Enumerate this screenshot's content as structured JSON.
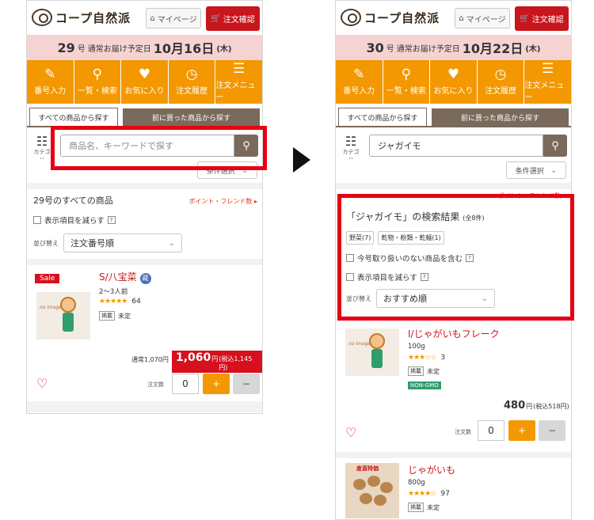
{
  "common": {
    "logo_text": "コープ自然派",
    "mypage_label": "マイページ",
    "order_confirm_label": "注文確認",
    "nav": [
      {
        "icon": "✎",
        "label": "番号入力"
      },
      {
        "icon": "⚲",
        "label": "一覧・検索"
      },
      {
        "icon": "♥",
        "label": "お気に入り"
      },
      {
        "icon": "◷",
        "label": "注文履歴"
      },
      {
        "icon": "☰",
        "label": "注文メニュー"
      }
    ],
    "tab_all": "すべての商品から探す",
    "tab_prev": "前に買った商品から探す",
    "category_label": "カテゴリ",
    "cond_select": "条件選択",
    "point_link": "ポイント・フレンド数 ▸",
    "reduce_items": "表示項目を減らす",
    "help": "?",
    "sort_label": "並び替え",
    "qty_label": "注文数",
    "qty_value": "0",
    "plus": "+",
    "minus": "−",
    "keisai_tag": "掲載",
    "keisai_value": "未定",
    "yen": "円"
  },
  "left": {
    "delivery": {
      "issue": "29",
      "issue_suffix": "号",
      "label": "通常お届け予定日",
      "date": "10月16日",
      "dow": "(木)"
    },
    "search": {
      "placeholder": "商品名、キーワードで探す",
      "value": ""
    },
    "list_title": "29号のすべての商品",
    "sort_value": "注文番号順",
    "product": {
      "sale_badge": "Sale",
      "name": "S/八宝菜",
      "badge": "蔵",
      "sub": "2〜3人前",
      "stars": "★★★★★",
      "rating_count": "64",
      "normal_price": "通常1,070円",
      "sale_price": "1,060",
      "tax_price": "(税込1,145円)"
    }
  },
  "right": {
    "delivery": {
      "issue": "30",
      "issue_suffix": "号",
      "label": "通常お届け予定日",
      "date": "10月22日",
      "dow": "(木)"
    },
    "search": {
      "placeholder": "商品名、キーワードで探す",
      "value": "ジャガイモ"
    },
    "result_title": "「ジャガイモ」の検索結果",
    "result_count": "(全8件)",
    "filter_tags": [
      "野菜(7)",
      "乾物・粉類・乾麺(1)"
    ],
    "exclude_unavailable": "今号取り扱いのない商品を含む",
    "sort_value": "おすすめ順",
    "product1": {
      "name": "I/じゃがいもフレーク",
      "sub": "100g",
      "stars": "★★★☆☆",
      "rating_count": "3",
      "nongmo": "NON-GMO",
      "price": "480",
      "tax_price": "(税込518円)"
    },
    "product2": {
      "name": "じゃがいも",
      "sub": "800g",
      "stars": "★★★★☆",
      "rating_count": "97",
      "badge_top": "産直特価"
    }
  }
}
